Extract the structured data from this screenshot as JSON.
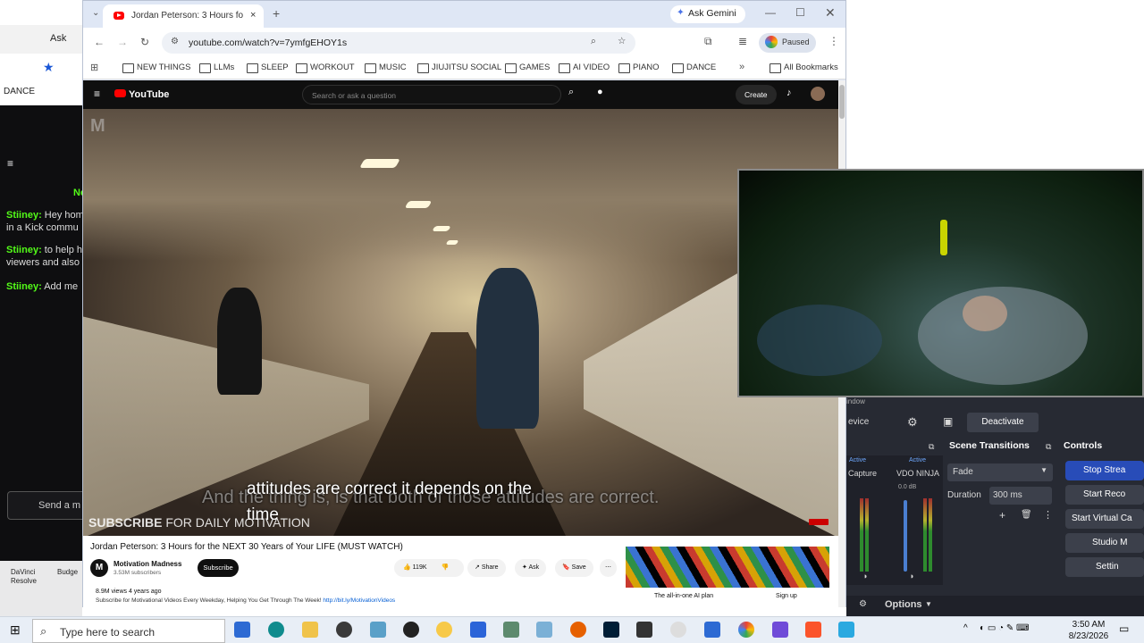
{
  "bg_window": {
    "ask_gemini": "Ask",
    "bookmark_dance": "DANCE",
    "chat": [
      {
        "user": "Stiiney:",
        "text": "Hey hom",
        "text2": "in a Kick commu"
      },
      {
        "user": "Stiiney:",
        "text": "to help h",
        "text2": "viewers and also"
      },
      {
        "user": "Stiiney:",
        "text": "Add me"
      }
    ],
    "chat_header_fragment": "Ne",
    "send_placeholder": "Send a m",
    "desktop_icons": [
      "DaVinci Resolve",
      "Budge"
    ]
  },
  "chrome": {
    "tab_title": "Jordan Peterson: 3 Hours fo",
    "ask_gemini": "Ask Gemini",
    "url": "youtube.com/watch?v=7ymfgEHOY1s",
    "profile_status": "Paused",
    "bookmarks": [
      "NEW THINGS",
      "LLMs",
      "SLEEP",
      "WORKOUT",
      "MUSIC",
      "JIUJITSU SOCIAL",
      "GAMES",
      "AI VIDEO",
      "PIANO",
      "DANCE"
    ],
    "all_bookmarks": "All Bookmarks"
  },
  "youtube": {
    "logo": "YouTube",
    "search_placeholder": "Search or ask a question",
    "create": "Create",
    "caption_back": "And the thing is, is that both of those attitudes are correct.",
    "caption_front_1": "attitudes are correct it depends on the",
    "caption_front_2": "time",
    "watermark_bold": "SUBSCRIBE",
    "watermark_rest": " FOR DAILY MOTIVATION",
    "title": "Jordan Peterson: 3 Hours for the NEXT 30 Years of Your LIFE (MUST WATCH)",
    "channel": "Motivation Madness",
    "subscribers": "3.53M subscribers",
    "subscribe": "Subscribe",
    "likes": "119K",
    "share": "Share",
    "ask": "Ask",
    "save": "Save",
    "views": "8.9M views  4 years ago",
    "description": "Subscribe for Motivational Videos Every Weekday, Helping You Get Through The Week! ",
    "description_link": "http://bit.ly/MotivationVideos",
    "ad_text": "The all-in-one AI plan",
    "ad_cta": "Sign up"
  },
  "obs": {
    "window_fragment": "indow",
    "device_fragment": "evice",
    "deactivate": "Deactivate",
    "scene_transitions": "Scene Transitions",
    "controls": "Controls",
    "transition": "Fade",
    "duration_label": "Duration",
    "duration_value": "300 ms",
    "active_1": "Active",
    "active_2": "Active",
    "capture_label": "Capture",
    "vdo_label": "VDO NINJA",
    "db_label": "0.0 dB",
    "options": "Options",
    "buttons": [
      "Stop Strea",
      "Start Reco",
      "Start Virtual Ca",
      "Studio M",
      "Settin"
    ]
  },
  "taskbar": {
    "search_placeholder": "Type here to search",
    "time": "3:50 AM",
    "date": "8/23/2026"
  }
}
